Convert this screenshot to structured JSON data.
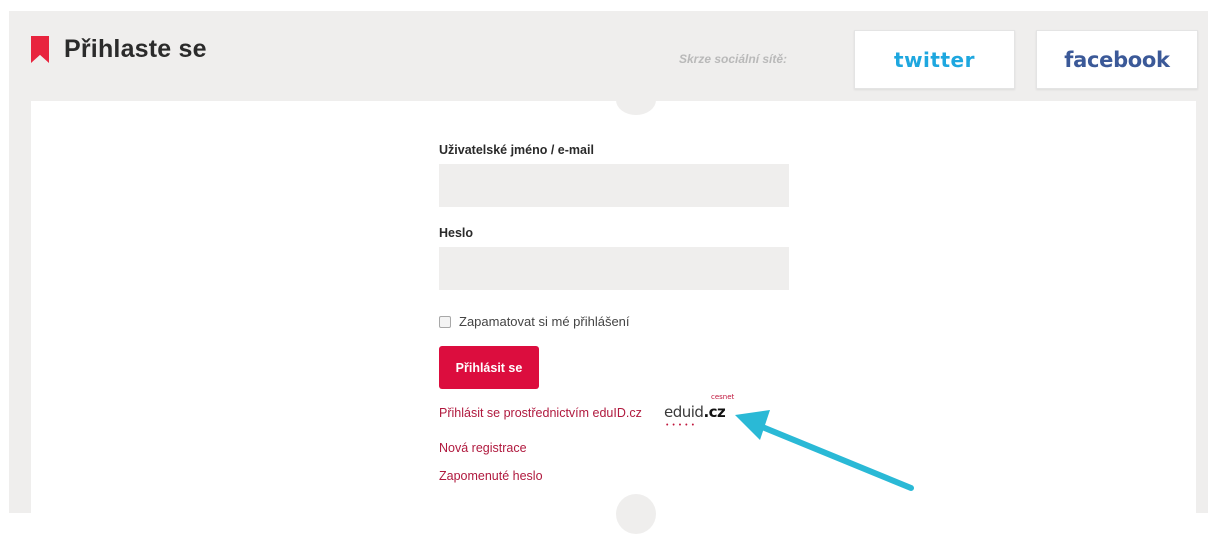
{
  "header": {
    "title": "Přihlaste se",
    "social_label": "Skrze sociální sítě:",
    "twitter_label": "twitter",
    "facebook_label": "facebook"
  },
  "form": {
    "username_label": "Uživatelské jméno / e-mail",
    "username_value": "",
    "password_label": "Heslo",
    "password_value": "",
    "remember_label": "Zapamatovat si mé přihlášení",
    "remember_checked": false,
    "login_button": "Přihlásit se"
  },
  "links": {
    "eduid": "Přihlásit se prostřednictvím eduID.cz",
    "register": "Nová registrace",
    "forgot": "Zapomenuté heslo"
  },
  "eduid_logo": {
    "main_a": "edu",
    "main_b": "id",
    "main_c": ".cz",
    "superscript": "cesnet"
  },
  "colors": {
    "accent": "#dc0d3e",
    "link": "#b0193e",
    "twitter": "#1ea7df",
    "facebook": "#3b5998",
    "arrow": "#2ab9d6"
  },
  "icons": {
    "bookmark": "bookmark-icon",
    "arrow": "arrow-annotation-icon"
  }
}
